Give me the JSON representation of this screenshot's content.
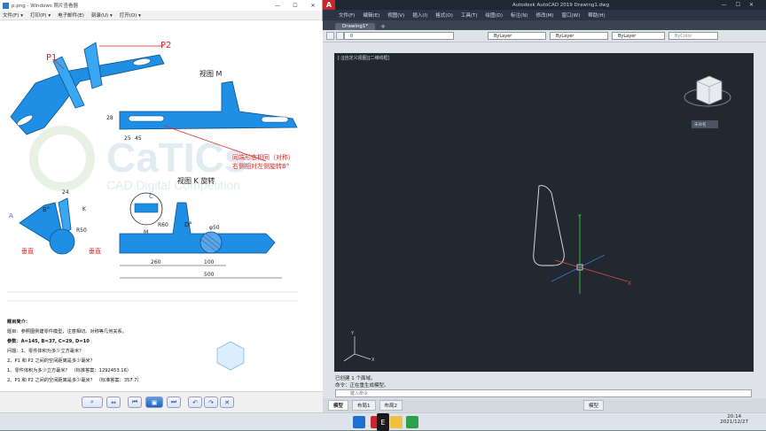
{
  "viewer": {
    "title": "p.png - Windows 照片查看器",
    "menu": [
      "文件(F) ▾",
      "打印(P) ▾",
      "电子邮件(E)",
      "刻录(U) ▾",
      "打开(O) ▾"
    ],
    "drawing": {
      "p1": "P1",
      "p2": "P2",
      "view_m": "视图 M",
      "view_k": "视图 K 旋转",
      "note1": "同端形态相同（对称）",
      "note2": "右侧相对左侧旋转B°",
      "dim_28": "28",
      "dim_25": "25",
      "dim_45": "45",
      "dim_24": "24",
      "dim_r50": "R50",
      "dim_phi50": "φ50",
      "dim_c": "C",
      "dim_d": "D°",
      "dim_b": "B°",
      "dim_a": "A",
      "dim_k": "K",
      "dim_m": "M",
      "dim_r60": "R60",
      "dim_260": "260",
      "dim_100": "100",
      "dim_500": "500",
      "label_vertical1": "垂直",
      "label_vertical2": "垂直",
      "watermark": "CaTICs",
      "watermark_sub": "CAD Digital Competition"
    },
    "info": {
      "line1": "题目简介：",
      "line2": "题目：参照图例建零件模型，注意相切、对称等几何关系。",
      "line3": "参数：A=145, B=37, C=29, D=10",
      "line4": "问题：1、零件体积为多少立方毫米？",
      "line5": "2、P1 和 P2 之间的空间距离是多少毫米？",
      "line6": "1、零件体积为多少立方毫米？        （标准答案：1292453.16）",
      "line7": "2、P1 和 P2 之间的空间距离是多少毫米？        （标准答案：357.7）"
    }
  },
  "acad": {
    "title": "Autodesk AutoCAD 2019    Drawing1.dwg",
    "menu": [
      "文件(F)",
      "编辑(E)",
      "视图(V)",
      "插入(I)",
      "格式(O)",
      "工具(T)",
      "绘图(D)",
      "标注(N)",
      "修改(M)",
      "窗口(W)",
      "帮助(H)"
    ],
    "tab": "Drawing1*",
    "layer": "0",
    "bylayer1": "ByLayer",
    "bylayer2": "ByLayer",
    "bylayer3": "ByLayer",
    "bycolor": "ByColor",
    "viewport_label": "[-][自定义视图][二维线框]",
    "viewcube_label": "未命名",
    "cmd1": "已创建 1 个面域。",
    "cmd2": "命令：正在重生成模型。",
    "cmd_prompt": "键入命令",
    "layout_tabs": [
      "模型",
      "布局1",
      "布局2"
    ],
    "status_model": "模型",
    "axis_x": "X",
    "axis_y": "Y"
  },
  "taskbar": {
    "clock_time": "20:14",
    "clock_date": "2021/12/27",
    "ime": "E"
  },
  "colors": {
    "part_blue": "#1f8fe6",
    "dim_red": "#d22",
    "acad_bg": "#212830",
    "acad_red": "#c4272d"
  }
}
